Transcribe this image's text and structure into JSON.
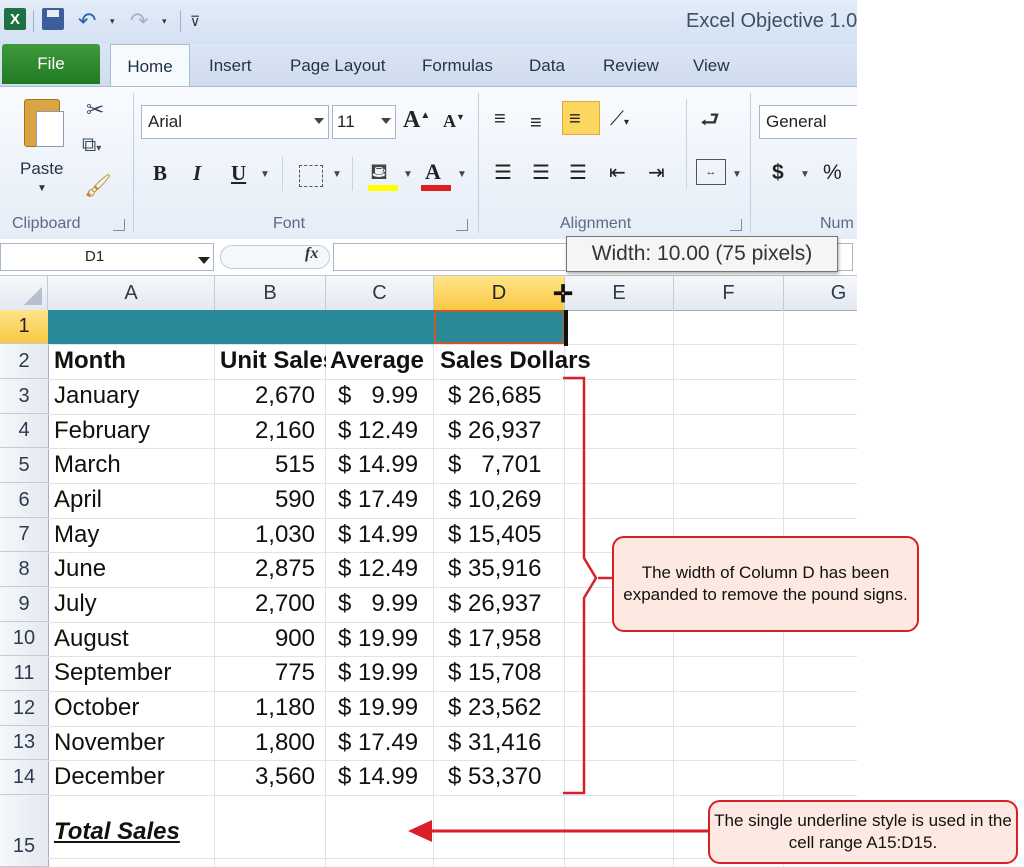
{
  "window": {
    "title": "Excel Objective 1.0",
    "icons": [
      "excel-logo",
      "save-icon",
      "undo-icon",
      "redo-icon",
      "customize-toolbar-icon"
    ]
  },
  "tabs": [
    "File",
    "Home",
    "Insert",
    "Page Layout",
    "Formulas",
    "Data",
    "Review",
    "View"
  ],
  "ribbon": {
    "clipboard": {
      "label": "Clipboard",
      "paste_label": "Paste"
    },
    "font": {
      "label": "Font",
      "font_name": "Arial",
      "font_size": "11",
      "bold": "B",
      "italic": "I",
      "underline": "U",
      "grow": "A",
      "shrink": "A",
      "color_letter": "A"
    },
    "alignment": {
      "label": "Alignment"
    },
    "number": {
      "label": "Num",
      "format": "General",
      "currency": "$",
      "percent": "%"
    }
  },
  "formula_bar": {
    "name_box": "D1",
    "fx": "fx",
    "formula": ""
  },
  "tooltip": {
    "text": "Width: 10.00 (75 pixels)"
  },
  "grid": {
    "columns": [
      "A",
      "B",
      "C",
      "D",
      "E",
      "F",
      "G"
    ],
    "selected_column": "D",
    "selected_row": "1",
    "row_numbers": [
      "1",
      "2",
      "3",
      "4",
      "5",
      "6",
      "7",
      "8",
      "9",
      "10",
      "11",
      "12",
      "13",
      "14",
      "15"
    ],
    "row1_fill_color": "#2b8a9a",
    "headers": [
      "Month",
      "Unit Sales",
      "Average",
      "Sales Dollars"
    ],
    "rows": [
      [
        "January",
        "2,670",
        "$   9.99",
        "$ 26,685"
      ],
      [
        "February",
        "2,160",
        "$ 12.49",
        "$ 26,937"
      ],
      [
        "March",
        "515",
        "$ 14.99",
        "$   7,701"
      ],
      [
        "April",
        "590",
        "$ 17.49",
        "$ 10,269"
      ],
      [
        "May",
        "1,030",
        "$ 14.99",
        "$ 15,405"
      ],
      [
        "June",
        "2,875",
        "$ 12.49",
        "$ 35,916"
      ],
      [
        "July",
        "2,700",
        "$   9.99",
        "$ 26,937"
      ],
      [
        "August",
        "900",
        "$ 19.99",
        "$ 17,958"
      ],
      [
        "September",
        "775",
        "$ 19.99",
        "$ 15,708"
      ],
      [
        "October",
        "1,180",
        "$ 19.99",
        "$ 23,562"
      ],
      [
        "November",
        "1,800",
        "$ 17.49",
        "$ 31,416"
      ],
      [
        "December",
        "3,560",
        "$ 14.99",
        "$ 53,370"
      ]
    ],
    "total_label": "Total Sales"
  },
  "callouts": {
    "column_width": "The width of Column D has been expanded to remove the pound signs.",
    "underline": "The single underline style is used in the cell range A15:D15."
  },
  "colors": {
    "annotation_red": "#d9202a",
    "callout_fill": "#fde9e1",
    "selection_highlight": "#f8c843"
  }
}
